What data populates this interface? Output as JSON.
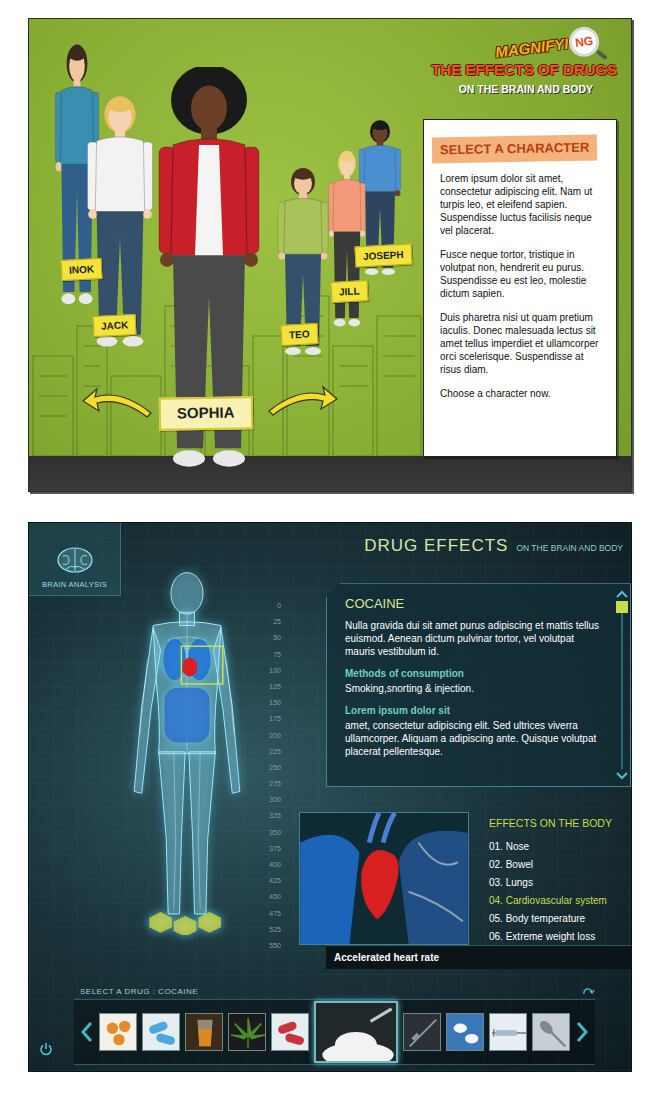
{
  "character_select": {
    "logo": {
      "word": "MAGNIFYI",
      "word_end": "NG",
      "title": "THE EFFECTS OF DRUGS",
      "subtitle": "ON THE BRAIN AND BODY"
    },
    "characters": [
      {
        "name": "INOK",
        "selected": false,
        "color": "#3a8fb0"
      },
      {
        "name": "JACK",
        "selected": false,
        "color": "#f2f2f2"
      },
      {
        "name": "SOPHIA",
        "selected": true,
        "color": "#c8202a"
      },
      {
        "name": "TEO",
        "selected": false,
        "color": "#a9c25a"
      },
      {
        "name": "JILL",
        "selected": false,
        "color": "#f29a7a"
      },
      {
        "name": "JOSEPH",
        "selected": false,
        "color": "#4a8fd0"
      }
    ],
    "panel": {
      "heading": "SELECT A CHARACTER",
      "paragraphs": [
        "Lorem ipsum dolor sit amet, consectetur adipiscing elit. Nam ut turpis leo, et eleifend sapien. Suspendisse luctus facilisis neque vel placerat.",
        "Fusce neque tortor, tristique in volutpat non, hendrerit eu purus. Suspendisse eu est leo, molestie dictum sapien.",
        "Duis pharetra nisi ut quam pretium iaculis. Donec malesuada lectus sit amet tellus imperdiet et ullamcorper orci scelerisque. Suspendisse at risus diam."
      ],
      "prompt": "Choose a character now."
    }
  },
  "drug_effects": {
    "brain_analysis": {
      "label": "BRAIN ANALYSIS"
    },
    "header": {
      "title": "DRUG EFFECTS",
      "subtitle": "ON THE BRAIN AND BODY"
    },
    "scale": [
      "0",
      "25",
      "50",
      "75",
      "100",
      "125",
      "150",
      "175",
      "200",
      "225",
      "250",
      "275",
      "300",
      "325",
      "350",
      "375",
      "400",
      "425",
      "450",
      "475",
      "525",
      "550"
    ],
    "info": {
      "title": "COCAINE",
      "intro": "Nulla gravida dui sit amet purus adipiscing et mattis tellus euismod. Aenean dictum pulvinar tortor, vel volutpat mauris vestibulum id.",
      "sections": [
        {
          "heading": "Methods of consumption",
          "text": "Smoking,snorting & injection."
        },
        {
          "heading": "Lorem ipsum dolor sit",
          "text": "amet, consectetur adipiscing elit. Sed ultrices viverra ullamcorper. Aliquam a adipiscing ante. Quisque volutpat placerat pellentesque."
        }
      ],
      "scroll_level": 0
    },
    "effects": {
      "heading": "EFFECTS ON THE BODY",
      "items": [
        {
          "label": "01. Nose",
          "selected": false
        },
        {
          "label": "02. Bowel",
          "selected": false
        },
        {
          "label": "03. Lungs",
          "selected": false
        },
        {
          "label": "04. Cardiovascular system",
          "selected": true
        },
        {
          "label": "05. Body temperature",
          "selected": false
        },
        {
          "label": "06. Extreme weight loss",
          "selected": false
        }
      ]
    },
    "effect_detail": "Accelerated heart rate",
    "drug_picker": {
      "label": "SELECT A DRUG : COCAINE",
      "drugs": [
        {
          "kind": "pills",
          "color": "#e8892a",
          "selected": false
        },
        {
          "kind": "capsules",
          "color": "#4aa8dc",
          "selected": false
        },
        {
          "kind": "drink",
          "color": "#d98a22",
          "selected": false
        },
        {
          "kind": "leaf",
          "color": "#4c8a2e",
          "selected": false
        },
        {
          "kind": "capsules",
          "color": "#c8343a",
          "selected": false
        },
        {
          "kind": "powder",
          "color": "#f2f2f2",
          "selected": true
        },
        {
          "kind": "needle",
          "color": "#8a98a4",
          "selected": false
        },
        {
          "kind": "tablets",
          "color": "#3a78b8",
          "selected": false
        },
        {
          "kind": "syringe",
          "color": "#a8bccb",
          "selected": false
        },
        {
          "kind": "spoon",
          "color": "#7d878d",
          "selected": false
        }
      ]
    }
  }
}
